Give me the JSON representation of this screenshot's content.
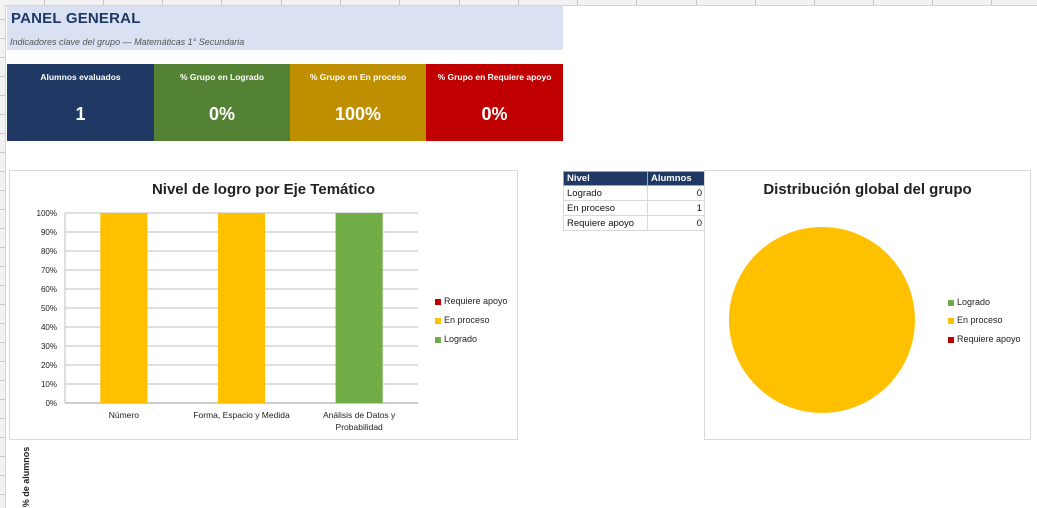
{
  "header": {
    "title": "PANEL GENERAL",
    "subtitle": "Indicadores clave del grupo — Matemáticas 1° Secundaria"
  },
  "kpis": [
    {
      "label": "Alumnos evaluados",
      "value": "1",
      "color": "#1f3864"
    },
    {
      "label": "% Grupo en Logrado",
      "value": "0%",
      "color": "#548235"
    },
    {
      "label": "% Grupo en En proceso",
      "value": "100%",
      "color": "#bf8f00"
    },
    {
      "label": "% Grupo en Requiere apoyo",
      "value": "0%",
      "color": "#c00000"
    }
  ],
  "level_table": {
    "headers": [
      "Nivel",
      "Alumnos"
    ],
    "rows": [
      {
        "nivel": "Logrado",
        "alumnos": "0"
      },
      {
        "nivel": "En proceso",
        "alumnos": "1"
      },
      {
        "nivel": "Requiere apoyo",
        "alumnos": "0"
      }
    ]
  },
  "colors": {
    "logrado": "#70ad47",
    "en_proceso": "#ffc000",
    "requiere_apoyo": "#c00000"
  },
  "chart_data": [
    {
      "type": "bar",
      "stacked": true,
      "title": "Nivel de logro por Eje Temático",
      "xlabel": "",
      "ylabel": "% de alumnos",
      "ylim": [
        0,
        100
      ],
      "yticks": [
        "0%",
        "10%",
        "20%",
        "30%",
        "40%",
        "50%",
        "60%",
        "70%",
        "80%",
        "90%",
        "100%"
      ],
      "categories": [
        "Número",
        "Forma, Espacio y Medida",
        "Análisis de Datos y Probabilidad"
      ],
      "series": [
        {
          "name": "Logrado",
          "values": [
            0,
            0,
            100
          ],
          "color": "#70ad47"
        },
        {
          "name": "En proceso",
          "values": [
            100,
            100,
            0
          ],
          "color": "#ffc000"
        },
        {
          "name": "Requiere apoyo",
          "values": [
            0,
            0,
            0
          ],
          "color": "#c00000"
        }
      ],
      "legend_order": [
        "Requiere apoyo",
        "En proceso",
        "Logrado"
      ],
      "legend_position": "right",
      "grid": true
    },
    {
      "type": "pie",
      "title": "Distribución global del grupo",
      "categories": [
        "Logrado",
        "En proceso",
        "Requiere apoyo"
      ],
      "values": [
        0,
        1,
        0
      ],
      "colors": [
        "#70ad47",
        "#ffc000",
        "#c00000"
      ],
      "legend_position": "right"
    }
  ]
}
